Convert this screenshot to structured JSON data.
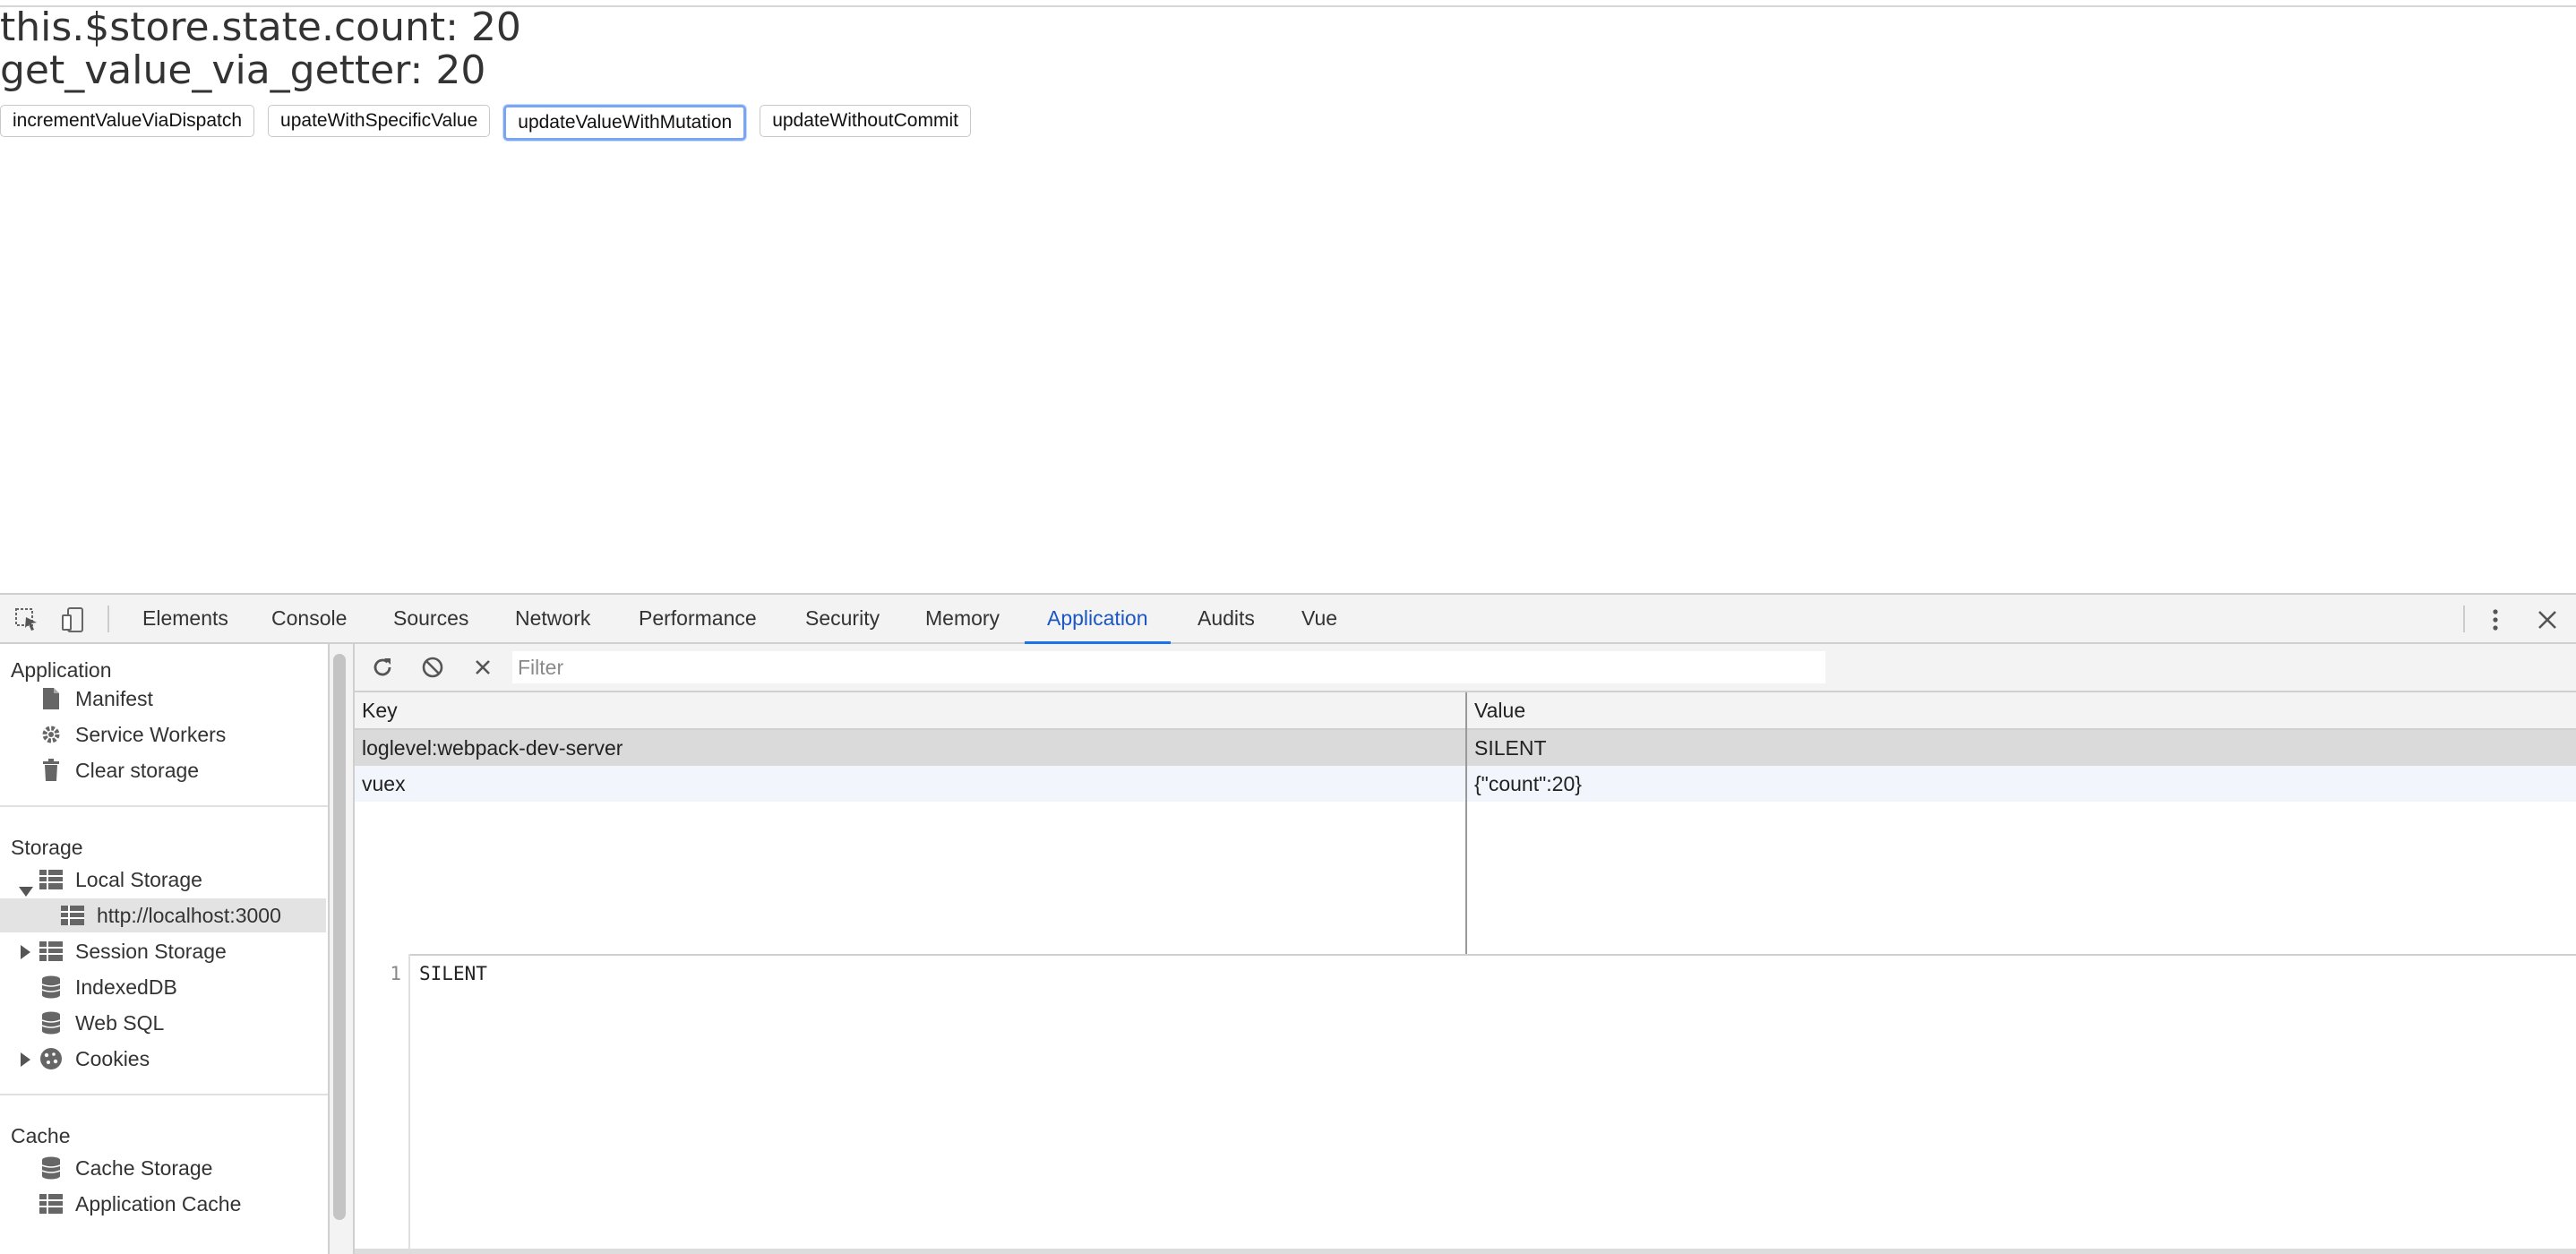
{
  "page": {
    "state_count_line": "this.$store.state.count: 20",
    "getter_line": "get_value_via_getter: 20",
    "buttons": [
      "incrementValueViaDispatch",
      "upateWithSpecificValue",
      "updateValueWithMutation",
      "updateWithoutCommit"
    ],
    "focused_button": "updateValueWithMutation"
  },
  "devtools": {
    "tabs": [
      "Elements",
      "Console",
      "Sources",
      "Network",
      "Performance",
      "Security",
      "Memory",
      "Application",
      "Audits",
      "Vue"
    ],
    "active_tab": "Application",
    "sidebar": {
      "application_header": "Application",
      "application_items": [
        "Manifest",
        "Service Workers",
        "Clear storage"
      ],
      "storage_header": "Storage",
      "local_storage": "Local Storage",
      "local_storage_origin": "http://localhost:3000",
      "session_storage": "Session Storage",
      "indexeddb": "IndexedDB",
      "websql": "Web SQL",
      "cookies": "Cookies",
      "cache_header": "Cache",
      "cache_storage": "Cache Storage",
      "application_cache": "Application Cache"
    },
    "toolbar": {
      "filter_placeholder": "Filter"
    },
    "table": {
      "headers": [
        "Key",
        "Value"
      ],
      "rows": [
        {
          "key": "loglevel:webpack-dev-server",
          "value": "SILENT",
          "selected": true
        },
        {
          "key": "vuex",
          "value": "{\"count\":20}",
          "selected": false
        }
      ]
    },
    "preview": {
      "line_number": "1",
      "content": "SILENT"
    }
  },
  "colors": {
    "accent": "#1a73e8",
    "focus_ring": "#7aa6f0",
    "selected_row": "#dadada"
  }
}
